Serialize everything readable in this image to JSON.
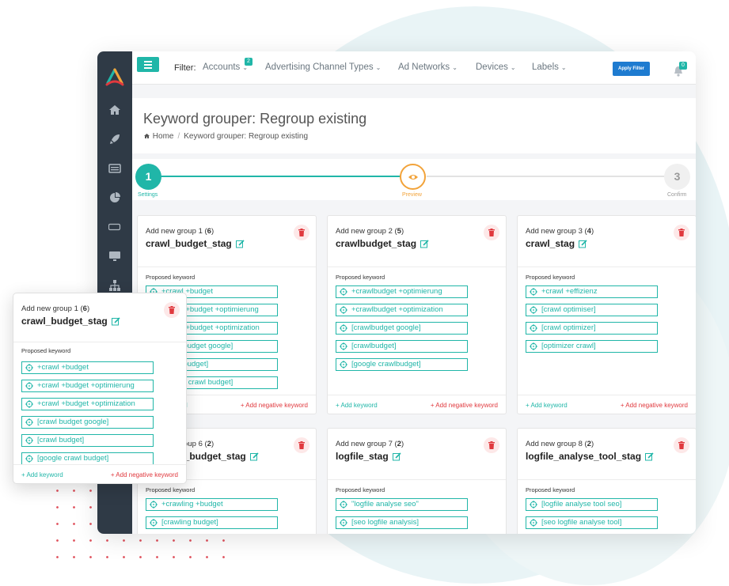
{
  "filter": {
    "label": "Filter:",
    "items": [
      {
        "label": "Accounts",
        "badge": "2"
      },
      {
        "label": "Advertising Channel Types"
      },
      {
        "label": "Ad Networks"
      },
      {
        "label": "Devices"
      },
      {
        "label": "Labels"
      }
    ],
    "apply_label": "Apply Filter"
  },
  "notifications": {
    "count": "0"
  },
  "page": {
    "title": "Keyword grouper: Regroup existing",
    "breadcrumb": {
      "home": "Home",
      "current": "Keyword grouper: Regroup existing"
    }
  },
  "stepper": {
    "steps": [
      {
        "number": "1",
        "label": "Settings",
        "state": "done"
      },
      {
        "number": "",
        "label": "Preview",
        "state": "active"
      },
      {
        "number": "3",
        "label": "Confirm",
        "state": "pending"
      }
    ]
  },
  "common": {
    "add_group_prefix": "Add new group",
    "proposed_label": "Proposed keyword",
    "add_keyword": "+ Add keyword",
    "add_negative": "+ Add negative keyword"
  },
  "groups": [
    {
      "number": "1",
      "count": "6",
      "name": "crawl_budget_stag",
      "keywords": [
        "+crawl +budget",
        "+crawl +budget +optimierung",
        "+crawl +budget +optimization",
        "[crawl budget google]",
        "[crawl budget]",
        "[google crawl budget]"
      ]
    },
    {
      "number": "2",
      "count": "5",
      "name": "crawlbudget_stag",
      "keywords": [
        "+crawlbudget +optimierung",
        "+crawlbudget +optimization",
        "[crawlbudget google]",
        "[crawlbudget]",
        "[google crawlbudget]"
      ]
    },
    {
      "number": "3",
      "count": "4",
      "name": "crawl_stag",
      "keywords": [
        "+crawl +effizienz",
        "[crawl optimiser]",
        "[crawl optimizer]",
        "[optimizer crawl]"
      ]
    },
    {
      "number": "6",
      "count": "2",
      "name": "crawling_budget_stag",
      "keywords": [
        "+crawling +budget",
        "[crawling budget]"
      ]
    },
    {
      "number": "7",
      "count": "2",
      "name": "logfile_stag",
      "keywords": [
        "\"logfile analyse seo\"",
        "[seo logfile analysis]"
      ]
    },
    {
      "number": "8",
      "count": "2",
      "name": "logfile_analyse_tool_stag",
      "keywords": [
        "[logfile analyse tool seo]",
        "[seo logfile analyse tool]"
      ]
    }
  ],
  "colors": {
    "accent": "#20b6a8",
    "sidebar": "#2f3a46",
    "danger": "#e0393e",
    "warning": "#f2a33a",
    "primary": "#1e7bd0"
  }
}
